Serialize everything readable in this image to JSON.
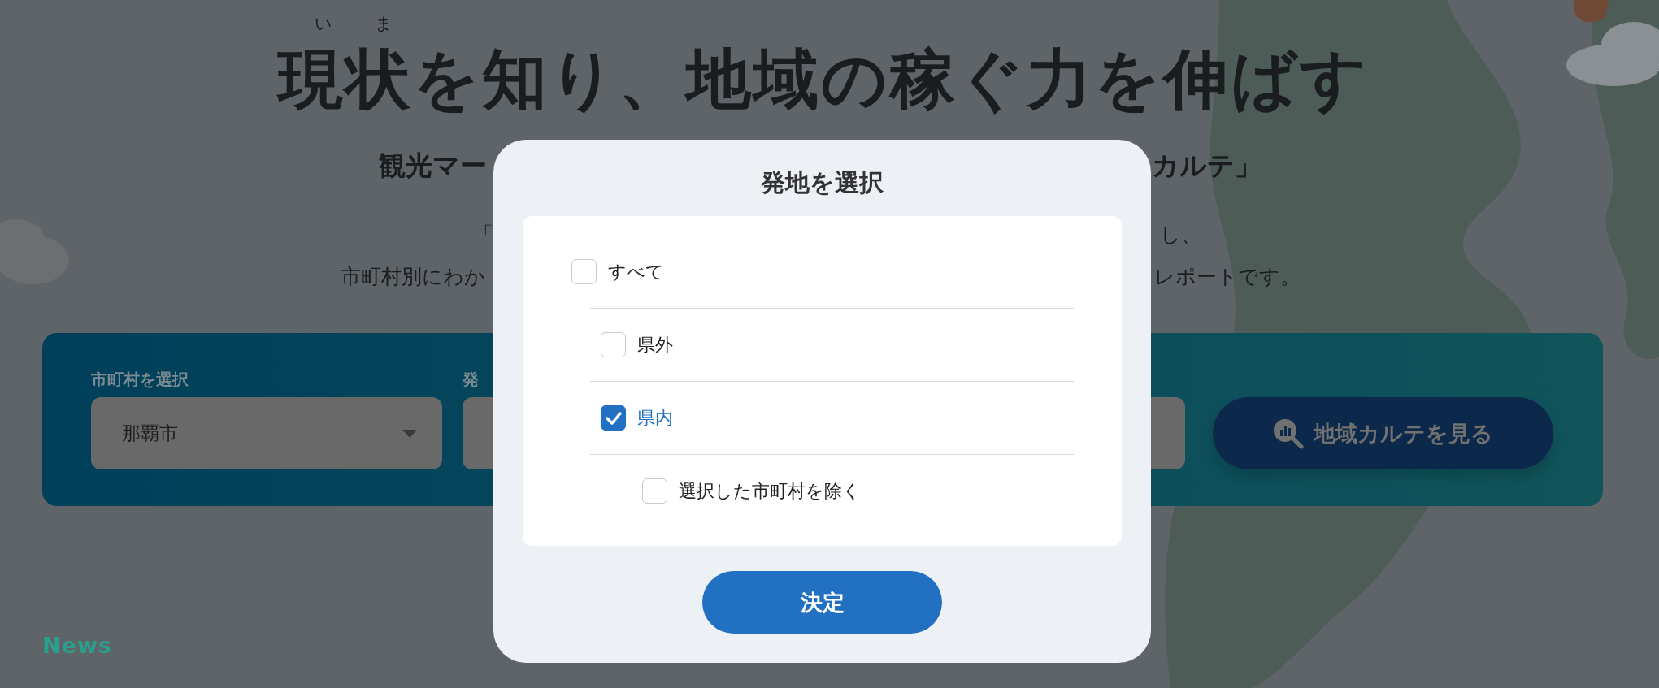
{
  "header": {
    "ruby": [
      "い",
      "ま"
    ],
    "title": "現状を知り、地域の稼ぐ力を伸ばす",
    "subtitle": [
      "観光マー",
      "カルテ」"
    ],
    "description_lines": [
      [
        "「",
        "し、"
      ],
      [
        "市町村別にわか",
        "レポートです。"
      ]
    ]
  },
  "search_panel": {
    "fields": [
      {
        "kind": "dropdown",
        "label": "市町村を選択",
        "value": "那覇市"
      },
      {
        "kind": "partial",
        "label": "発"
      },
      {
        "kind": "partial"
      }
    ],
    "button": "地域カルテを見る"
  },
  "news": {
    "label": "News"
  },
  "dialog": {
    "title": "発地を選択",
    "options": [
      {
        "label": "すべて",
        "checked": false,
        "children": [
          {
            "label": "県外",
            "checked": false
          },
          {
            "label": "県内",
            "checked": true,
            "children": [
              {
                "label": "選択した市町村を除く",
                "checked": false
              }
            ]
          }
        ]
      }
    ],
    "button": "決定"
  }
}
